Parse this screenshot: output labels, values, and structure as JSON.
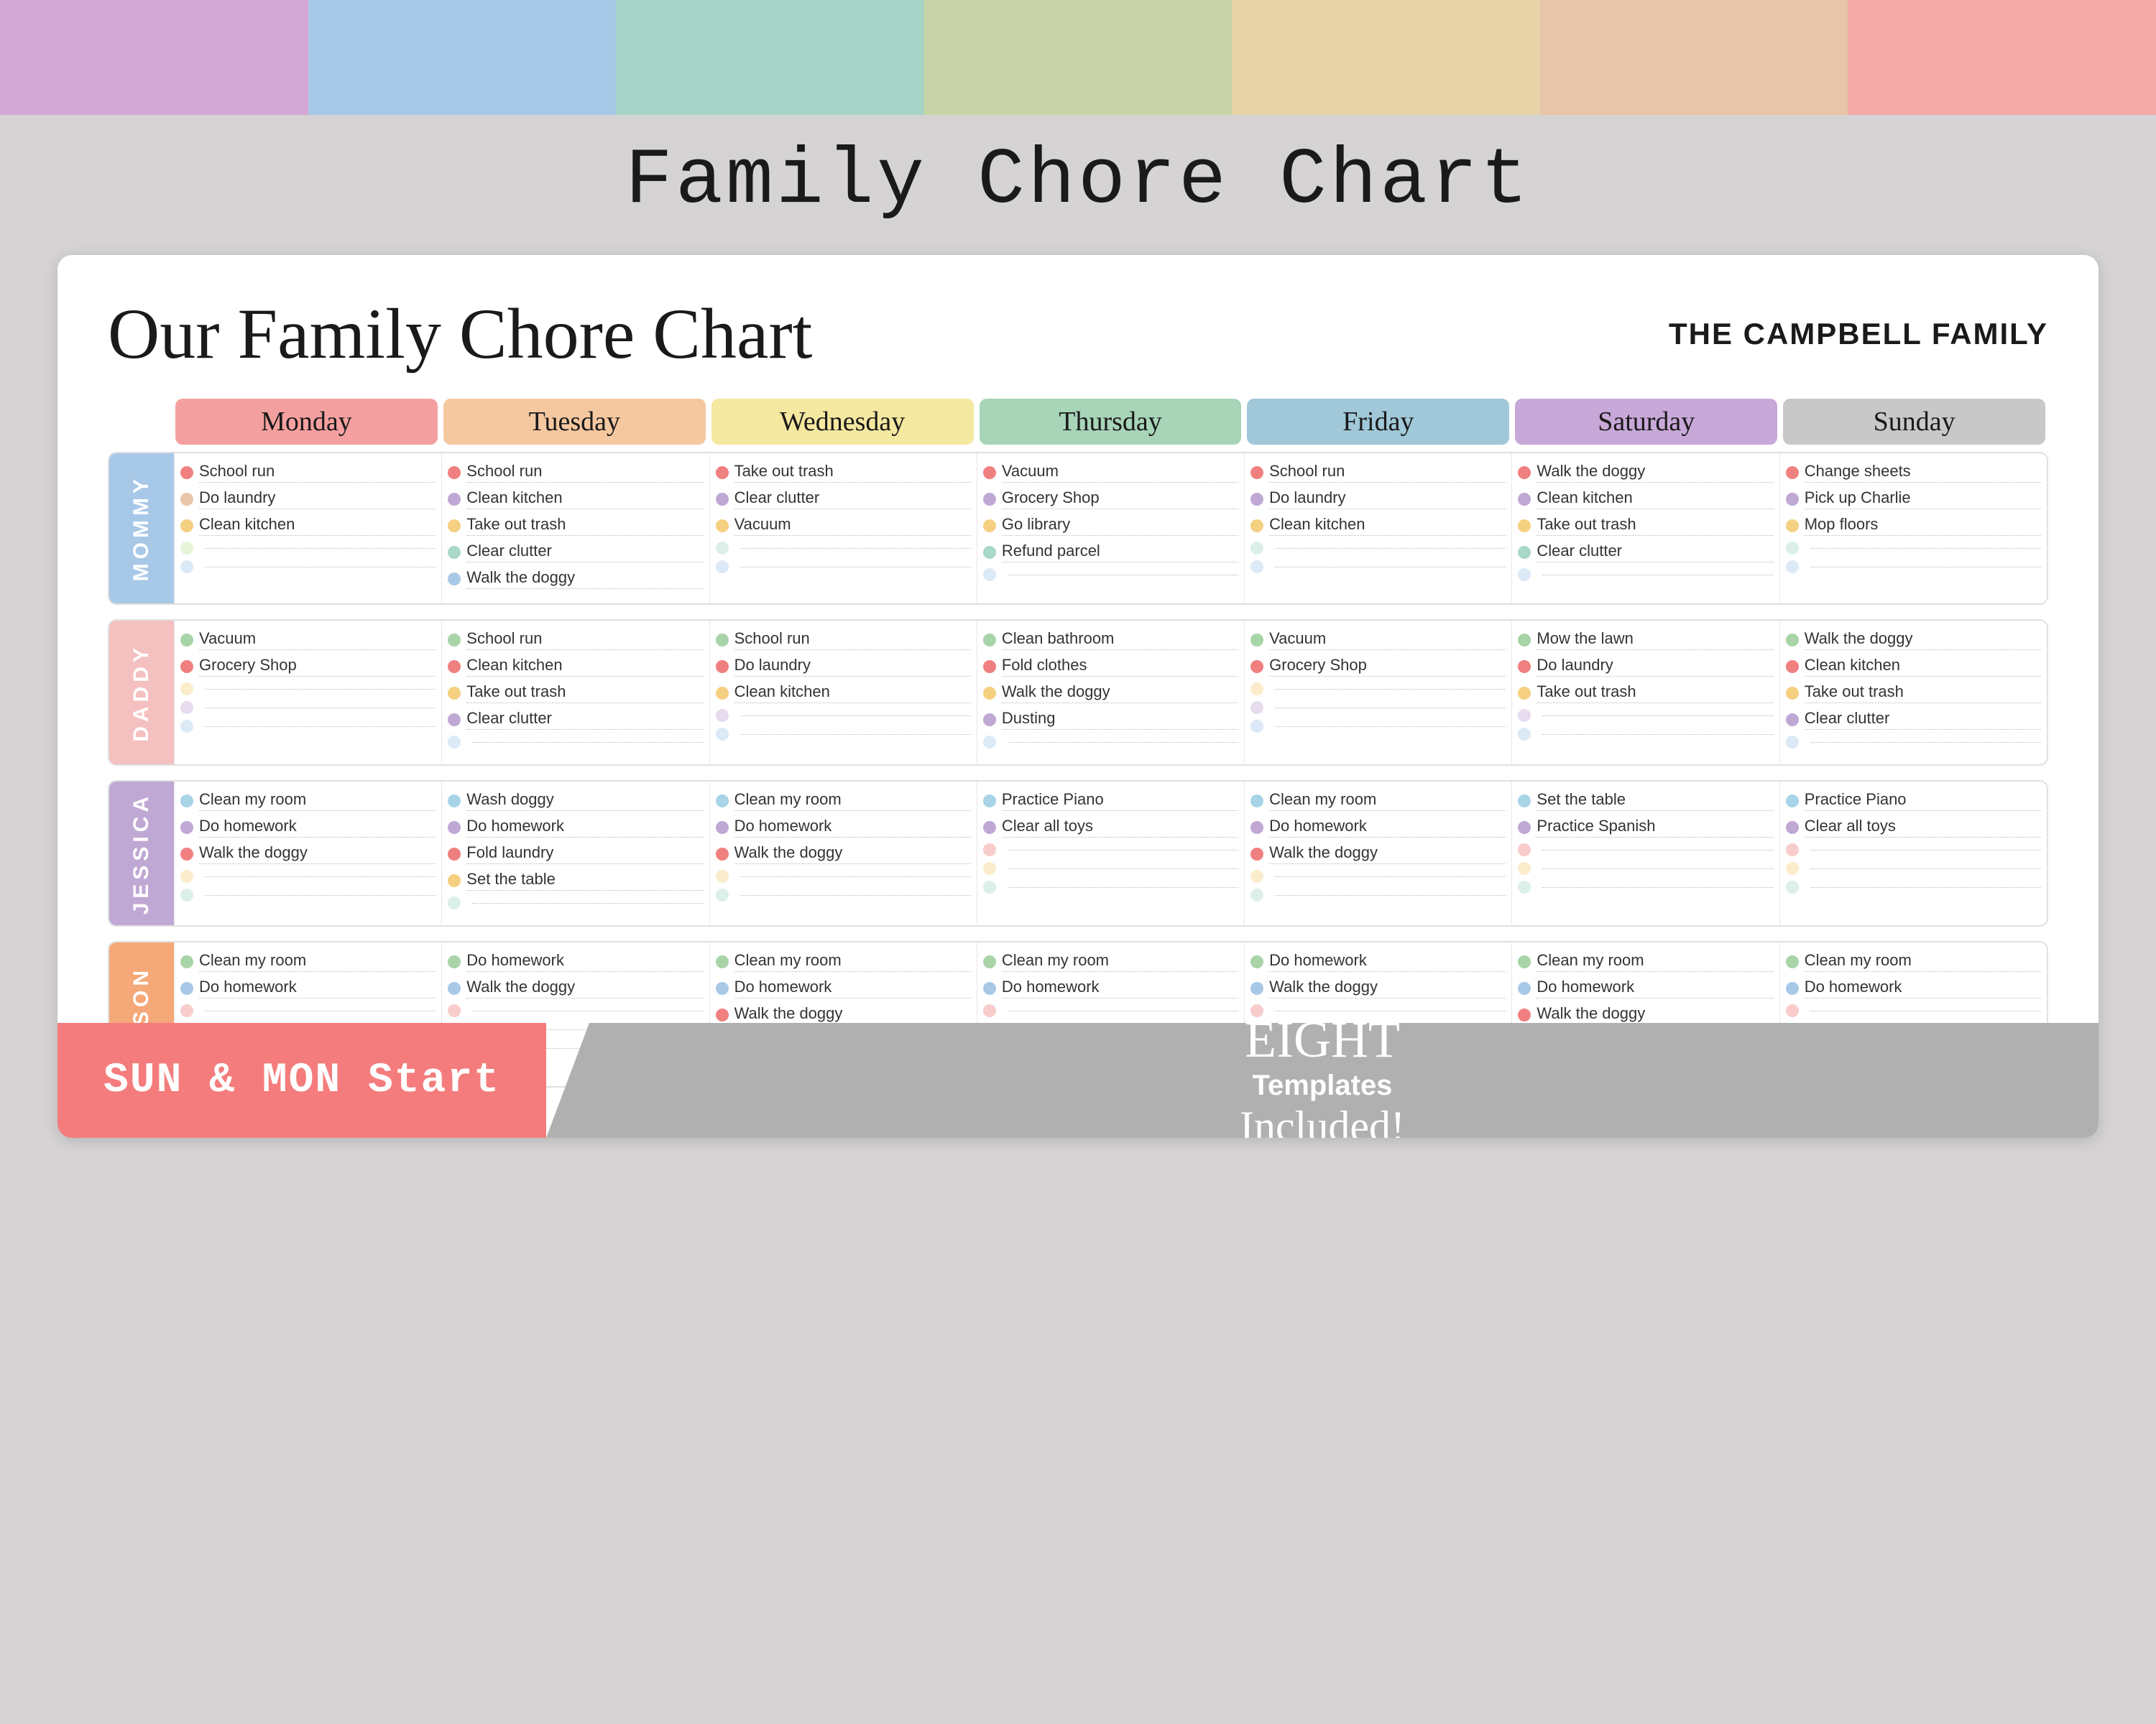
{
  "page": {
    "title": "Family Chore Chart",
    "top_colors": [
      "#d4a8d4",
      "#a8c8e8",
      "#a8d4c8",
      "#c8d4a8",
      "#e8d4a8",
      "#e8c4a8",
      "#e8a8a8"
    ],
    "card_title": "Our Family Chore Chart",
    "family_name": "THE CAMPBELL FAMILY",
    "days": [
      "Monday",
      "Tuesday",
      "Wednesday",
      "Thursday",
      "Friday",
      "Saturday",
      "Sunday"
    ],
    "day_colors": [
      "#f5a0a0",
      "#f5c8a0",
      "#f5e8a0",
      "#a0d4a0",
      "#a0c8d4",
      "#c0a8d4",
      "#c8c8c8"
    ],
    "bottom_left": "SUN & MON Start",
    "bottom_right_line1": "EIGHT",
    "bottom_right_line2": "Templates",
    "bottom_right_line3": "Included!",
    "persons": [
      {
        "name": "MOMMY",
        "color": "#a8c8e8",
        "days": [
          [
            {
              "dot": "#f08080",
              "text": "School run"
            },
            {
              "dot": "#e8c4a8",
              "text": "Do laundry"
            },
            {
              "dot": "#f5d080",
              "text": "Clean kitchen"
            },
            {
              "dot": "#c4e4a0",
              "text": ""
            },
            {
              "dot": "#a8c8e8",
              "text": ""
            }
          ],
          [
            {
              "dot": "#f08080",
              "text": "School run"
            },
            {
              "dot": "#c0a8d4",
              "text": "Clean kitchen"
            },
            {
              "dot": "#f5d080",
              "text": "Take out trash"
            },
            {
              "dot": "#a8d8c8",
              "text": "Clear clutter"
            },
            {
              "dot": "#a8c8e8",
              "text": "Walk the doggy"
            }
          ],
          [
            {
              "dot": "#f08080",
              "text": "Take out trash"
            },
            {
              "dot": "#c0a8d4",
              "text": "Clear clutter"
            },
            {
              "dot": "#f5d080",
              "text": "Vacuum"
            },
            {
              "dot": "#a8d8c8",
              "text": ""
            },
            {
              "dot": "#a8c8e8",
              "text": ""
            }
          ],
          [
            {
              "dot": "#f08080",
              "text": "Vacuum"
            },
            {
              "dot": "#c0a8d4",
              "text": "Grocery Shop"
            },
            {
              "dot": "#f5d080",
              "text": "Go library"
            },
            {
              "dot": "#a8d8c8",
              "text": "Refund parcel"
            },
            {
              "dot": "#a8c8e8",
              "text": ""
            }
          ],
          [
            {
              "dot": "#f08080",
              "text": "School run"
            },
            {
              "dot": "#c0a8d4",
              "text": "Do laundry"
            },
            {
              "dot": "#f5d080",
              "text": "Clean kitchen"
            },
            {
              "dot": "#a8d8c8",
              "text": ""
            },
            {
              "dot": "#a8c8e8",
              "text": ""
            }
          ],
          [
            {
              "dot": "#f08080",
              "text": "Walk the doggy"
            },
            {
              "dot": "#c0a8d4",
              "text": "Clean kitchen"
            },
            {
              "dot": "#f5d080",
              "text": "Take out trash"
            },
            {
              "dot": "#a8d8c8",
              "text": "Clear clutter"
            },
            {
              "dot": "#a8c8e8",
              "text": ""
            }
          ],
          [
            {
              "dot": "#f08080",
              "text": "Change sheets"
            },
            {
              "dot": "#c0a8d4",
              "text": "Pick up Charlie"
            },
            {
              "dot": "#f5d080",
              "text": "Mop floors"
            },
            {
              "dot": "#a8d8c8",
              "text": ""
            },
            {
              "dot": "#a8c8e8",
              "text": ""
            }
          ]
        ]
      },
      {
        "name": "DADDY",
        "color": "#f5c0c0",
        "days": [
          [
            {
              "dot": "#a8d4a8",
              "text": "Vacuum"
            },
            {
              "dot": "#f08080",
              "text": "Grocery Shop"
            },
            {
              "dot": "#f5d080",
              "text": ""
            },
            {
              "dot": "#c0a8d4",
              "text": ""
            },
            {
              "dot": "#a8c8e8",
              "text": ""
            }
          ],
          [
            {
              "dot": "#a8d4a8",
              "text": "School run"
            },
            {
              "dot": "#f08080",
              "text": "Clean kitchen"
            },
            {
              "dot": "#f5d080",
              "text": "Take out trash"
            },
            {
              "dot": "#c0a8d4",
              "text": "Clear clutter"
            },
            {
              "dot": "#a8c8e8",
              "text": ""
            }
          ],
          [
            {
              "dot": "#a8d4a8",
              "text": "School run"
            },
            {
              "dot": "#f08080",
              "text": "Do laundry"
            },
            {
              "dot": "#f5d080",
              "text": "Clean kitchen"
            },
            {
              "dot": "#c0a8d4",
              "text": ""
            },
            {
              "dot": "#a8c8e8",
              "text": ""
            }
          ],
          [
            {
              "dot": "#a8d4a8",
              "text": "Clean bathroom"
            },
            {
              "dot": "#f08080",
              "text": "Fold clothes"
            },
            {
              "dot": "#f5d080",
              "text": "Walk the doggy"
            },
            {
              "dot": "#c0a8d4",
              "text": "Dusting"
            },
            {
              "dot": "#a8c8e8",
              "text": ""
            }
          ],
          [
            {
              "dot": "#a8d4a8",
              "text": "Vacuum"
            },
            {
              "dot": "#f08080",
              "text": "Grocery Shop"
            },
            {
              "dot": "#f5d080",
              "text": ""
            },
            {
              "dot": "#c0a8d4",
              "text": ""
            },
            {
              "dot": "#a8c8e8",
              "text": ""
            }
          ],
          [
            {
              "dot": "#a8d4a8",
              "text": "Mow the lawn"
            },
            {
              "dot": "#f08080",
              "text": "Do laundry"
            },
            {
              "dot": "#f5d080",
              "text": "Take out trash"
            },
            {
              "dot": "#c0a8d4",
              "text": ""
            },
            {
              "dot": "#a8c8e8",
              "text": ""
            }
          ],
          [
            {
              "dot": "#a8d4a8",
              "text": "Walk the doggy"
            },
            {
              "dot": "#f08080",
              "text": "Clean kitchen"
            },
            {
              "dot": "#f5d080",
              "text": "Take out trash"
            },
            {
              "dot": "#c0a8d4",
              "text": "Clear clutter"
            },
            {
              "dot": "#a8c8e8",
              "text": ""
            }
          ]
        ]
      },
      {
        "name": "JESSICA",
        "color": "#c0a8d4",
        "days": [
          [
            {
              "dot": "#a8d4e8",
              "text": "Clean my room"
            },
            {
              "dot": "#c0a8d4",
              "text": "Do homework"
            },
            {
              "dot": "#f08080",
              "text": "Walk the doggy"
            },
            {
              "dot": "#f5d080",
              "text": ""
            },
            {
              "dot": "#a8d8c8",
              "text": ""
            }
          ],
          [
            {
              "dot": "#a8d4e8",
              "text": "Wash doggy"
            },
            {
              "dot": "#c0a8d4",
              "text": "Do homework"
            },
            {
              "dot": "#f08080",
              "text": "Fold laundry"
            },
            {
              "dot": "#f5d080",
              "text": "Set the table"
            },
            {
              "dot": "#a8d8c8",
              "text": ""
            }
          ],
          [
            {
              "dot": "#a8d4e8",
              "text": "Clean my room"
            },
            {
              "dot": "#c0a8d4",
              "text": "Do homework"
            },
            {
              "dot": "#f08080",
              "text": "Walk the doggy"
            },
            {
              "dot": "#f5d080",
              "text": ""
            },
            {
              "dot": "#a8d8c8",
              "text": ""
            }
          ],
          [
            {
              "dot": "#a8d4e8",
              "text": "Practice Piano"
            },
            {
              "dot": "#c0a8d4",
              "text": "Clear all toys"
            },
            {
              "dot": "#f08080",
              "text": ""
            },
            {
              "dot": "#f5d080",
              "text": ""
            },
            {
              "dot": "#a8d8c8",
              "text": ""
            }
          ],
          [
            {
              "dot": "#a8d4e8",
              "text": "Clean my room"
            },
            {
              "dot": "#c0a8d4",
              "text": "Do homework"
            },
            {
              "dot": "#f08080",
              "text": "Walk the doggy"
            },
            {
              "dot": "#f5d080",
              "text": ""
            },
            {
              "dot": "#a8d8c8",
              "text": ""
            }
          ],
          [
            {
              "dot": "#a8d4e8",
              "text": "Set the table"
            },
            {
              "dot": "#c0a8d4",
              "text": "Practice Spanish"
            },
            {
              "dot": "#f08080",
              "text": ""
            },
            {
              "dot": "#f5d080",
              "text": ""
            },
            {
              "dot": "#a8d8c8",
              "text": ""
            }
          ],
          [
            {
              "dot": "#a8d4e8",
              "text": "Practice Piano"
            },
            {
              "dot": "#c0a8d4",
              "text": "Clear all toys"
            },
            {
              "dot": "#f08080",
              "text": ""
            },
            {
              "dot": "#f5d080",
              "text": ""
            },
            {
              "dot": "#a8d8c8",
              "text": ""
            }
          ]
        ]
      },
      {
        "name": "JASON",
        "color": "#f5a878",
        "days": [
          [
            {
              "dot": "#a8d4a8",
              "text": "Clean my room"
            },
            {
              "dot": "#a8c8e8",
              "text": "Do homework"
            },
            {
              "dot": "#f08080",
              "text": ""
            },
            {
              "dot": "#c0a8d4",
              "text": ""
            },
            {
              "dot": "#f5d080",
              "text": ""
            }
          ],
          [
            {
              "dot": "#a8d4a8",
              "text": "Do homework"
            },
            {
              "dot": "#a8c8e8",
              "text": "Walk the doggy"
            },
            {
              "dot": "#f08080",
              "text": ""
            },
            {
              "dot": "#c0a8d4",
              "text": ""
            },
            {
              "dot": "#f5d080",
              "text": ""
            }
          ],
          [
            {
              "dot": "#a8d4a8",
              "text": "Clean my room"
            },
            {
              "dot": "#a8c8e8",
              "text": "Do homework"
            },
            {
              "dot": "#f08080",
              "text": "Walk the doggy"
            },
            {
              "dot": "#c0a8d4",
              "text": ""
            },
            {
              "dot": "#f5d080",
              "text": ""
            }
          ],
          [
            {
              "dot": "#a8d4a8",
              "text": "Clean my room"
            },
            {
              "dot": "#a8c8e8",
              "text": "Do homework"
            },
            {
              "dot": "#f08080",
              "text": ""
            },
            {
              "dot": "#c0a8d4",
              "text": ""
            },
            {
              "dot": "#f5d080",
              "text": ""
            }
          ],
          [
            {
              "dot": "#a8d4a8",
              "text": "Do homework"
            },
            {
              "dot": "#a8c8e8",
              "text": "Walk the doggy"
            },
            {
              "dot": "#f08080",
              "text": ""
            },
            {
              "dot": "#c0a8d4",
              "text": ""
            },
            {
              "dot": "#f5d080",
              "text": ""
            }
          ],
          [
            {
              "dot": "#a8d4a8",
              "text": "Clean my room"
            },
            {
              "dot": "#a8c8e8",
              "text": "Do homework"
            },
            {
              "dot": "#f08080",
              "text": "Walk the doggy"
            },
            {
              "dot": "#c0a8d4",
              "text": ""
            },
            {
              "dot": "#f5d080",
              "text": ""
            }
          ],
          [
            {
              "dot": "#a8d4a8",
              "text": "Clean my room"
            },
            {
              "dot": "#a8c8e8",
              "text": "Do homework"
            },
            {
              "dot": "#f08080",
              "text": ""
            },
            {
              "dot": "#c0a8d4",
              "text": ""
            },
            {
              "dot": "#f5d080",
              "text": ""
            }
          ]
        ]
      }
    ]
  }
}
